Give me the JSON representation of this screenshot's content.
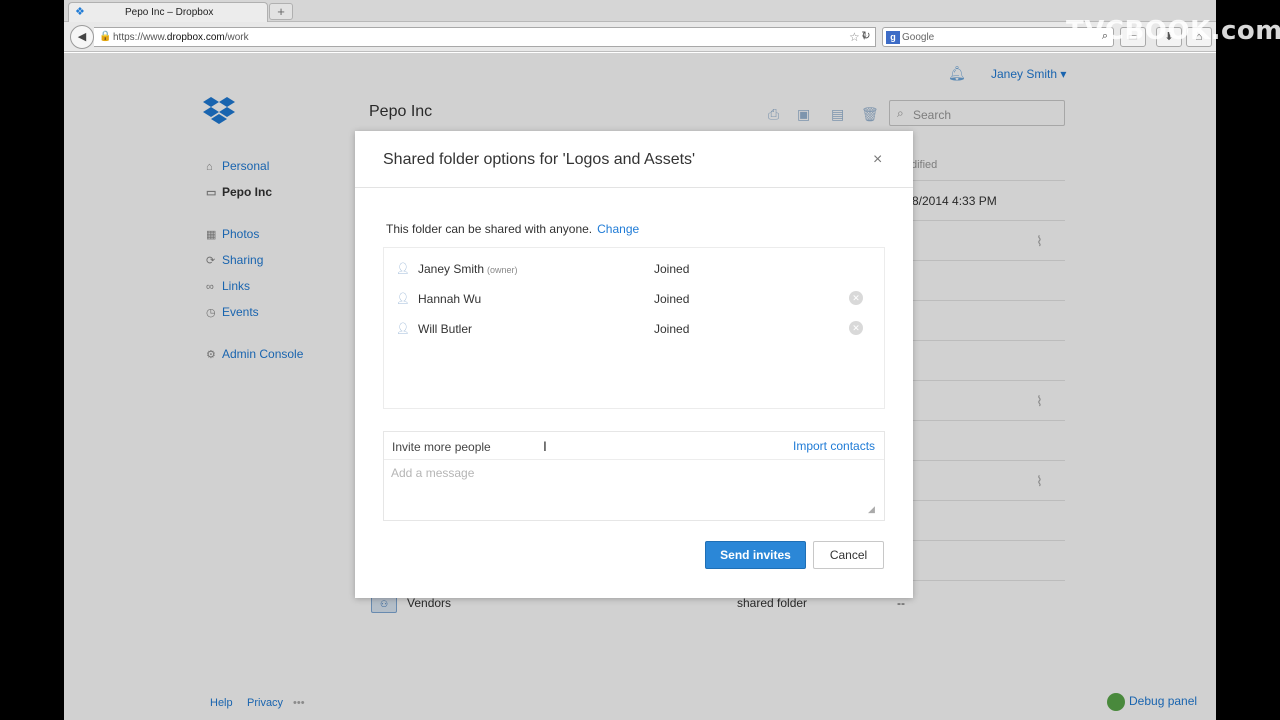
{
  "browser": {
    "tab_title": "Pepo Inc – Dropbox",
    "new_tab": "+",
    "url_prefix": "https://www.",
    "url_domain": "dropbox.com",
    "url_path": "/work",
    "search_engine": "Google"
  },
  "watermark": "TVCBOOK.com",
  "header": {
    "user_menu": "Janey Smith ▾",
    "breadcrumb": "Pepo Inc",
    "search_placeholder": "Search"
  },
  "sidebar": {
    "items": [
      {
        "label": "Personal",
        "icon": "home-icon"
      },
      {
        "label": "Pepo Inc",
        "icon": "briefcase-icon"
      },
      {
        "label": "Photos",
        "icon": "photos-icon"
      },
      {
        "label": "Sharing",
        "icon": "sharing-icon"
      },
      {
        "label": "Links",
        "icon": "link-icon"
      },
      {
        "label": "Events",
        "icon": "clock-icon"
      },
      {
        "label": "Admin Console",
        "icon": "gear-icon"
      }
    ]
  },
  "file_list": {
    "modified_header": "dified",
    "modified_value": "8/2014 4:33 PM",
    "visible_row": {
      "name": "Vendors",
      "kind": "shared folder",
      "modified": "--"
    }
  },
  "footer": {
    "help": "Help",
    "privacy": "Privacy",
    "more": "•••",
    "debug": "Debug panel"
  },
  "modal": {
    "title": "Shared folder options for 'Logos and Assets'",
    "close": "×",
    "policy_text": "This folder can be shared with anyone.",
    "policy_link": "Change",
    "members": [
      {
        "name": "Janey Smith",
        "role": "(owner)",
        "status": "Joined",
        "removable": false
      },
      {
        "name": "Hannah Wu",
        "role": "",
        "status": "Joined",
        "removable": true
      },
      {
        "name": "Will Butler",
        "role": "",
        "status": "Joined",
        "removable": true
      }
    ],
    "invite_placeholder": "Invite more people",
    "import_contacts": "Import contacts",
    "message_placeholder": "Add a message",
    "send_label": "Send invites",
    "cancel_label": "Cancel"
  },
  "colors": {
    "accent": "#2b87d7",
    "link": "#1f7bd6"
  }
}
